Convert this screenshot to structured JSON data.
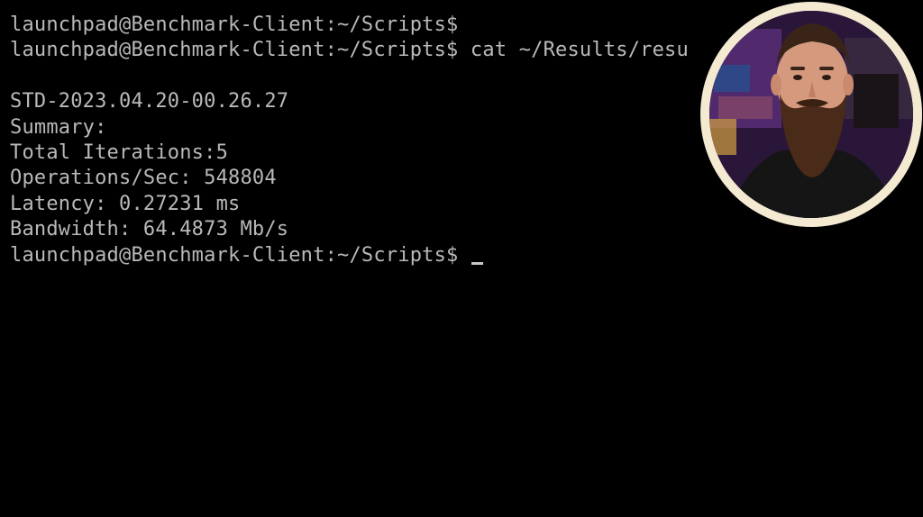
{
  "terminal": {
    "lines": [
      "launchpad@Benchmark-Client:~/Scripts$",
      "launchpad@Benchmark-Client:~/Scripts$ cat ~/Results/resu",
      "",
      "STD-2023.04.20-00.26.27",
      "Summary:",
      "Total Iterations:5",
      "Operations/Sec: 548804",
      "Latency: 0.27231 ms",
      "Bandwidth: 64.4873 Mb/s"
    ],
    "prompt": "launchpad@Benchmark-Client:~/Scripts$ ",
    "text_color": "#b9b9b9",
    "background": "#000000"
  },
  "webcam": {
    "ring_color": "#f4ead2",
    "background_color": "#3a1f55",
    "subject": "bearded-man"
  }
}
